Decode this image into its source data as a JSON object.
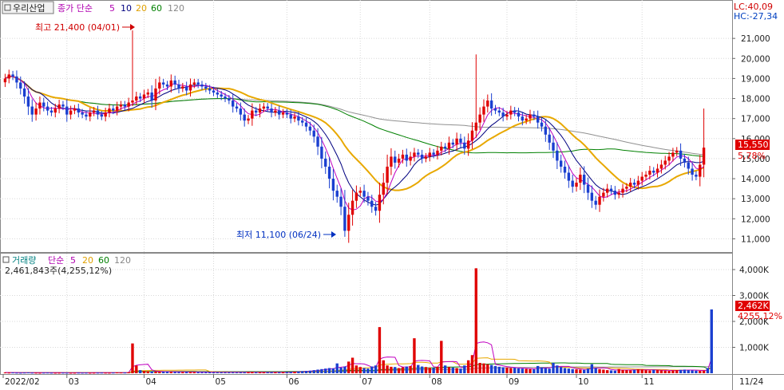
{
  "legend": {
    "stock_name": "우리산업",
    "ma_label": "종가 단순",
    "periods": [
      "5",
      "10",
      "20",
      "60",
      "120"
    ]
  },
  "readouts": {
    "lc": "LC:40,09",
    "hc": "HC:-27,34"
  },
  "annotations": {
    "high": "최고 21,400 (04/01)",
    "low": "최저 11,100 (06/24)"
  },
  "current": {
    "price": "15,550",
    "change": "5,78%",
    "volume": "2,462K",
    "volume_change": "4255,12%",
    "date": "11/24"
  },
  "volume_legend": {
    "label": "거래량",
    "ma_label": "단순",
    "periods": [
      "5",
      "20",
      "60",
      "120"
    ],
    "readout": "2,461,843주(4,255,12%)"
  },
  "colors": {
    "up": "#e00000",
    "down": "#1a3fd0",
    "ma5": "#c000c0",
    "ma10": "#000080",
    "ma20": "#e8a800",
    "ma60": "#008000",
    "ma120": "#909090",
    "grid": "#d8d8d8"
  },
  "chart_data": {
    "type": "candlestick",
    "price_axis": {
      "ticks": [
        "11,000",
        "12,000",
        "13,000",
        "14,000",
        "15,000",
        "16,000",
        "17,000",
        "18,000",
        "19,000",
        "20,000",
        "21,000"
      ],
      "range": [
        10500,
        22200
      ]
    },
    "volume_axis": {
      "ticks": [
        "1,000K",
        "2,000K",
        "3,000K",
        "4,000K"
      ],
      "range": [
        0,
        4400
      ]
    },
    "x_labels": [
      "2022/02",
      "03",
      "04",
      "05",
      "06",
      "07",
      "08",
      "09",
      "10",
      "11"
    ],
    "closes": [
      19000,
      19200,
      19100,
      18800,
      18500,
      18100,
      17600,
      17200,
      17500,
      17800,
      17600,
      17400,
      17300,
      17500,
      17700,
      17600,
      17200,
      17400,
      17500,
      17300,
      17200,
      17100,
      17300,
      17400,
      17200,
      17100,
      17300,
      17500,
      17400,
      17600,
      17700,
      17600,
      17800,
      17900,
      18100,
      18000,
      18200,
      18300,
      17900,
      18500,
      18800,
      18700,
      18600,
      18900,
      18700,
      18500,
      18600,
      18400,
      18700,
      18800,
      18700,
      18600,
      18500,
      18400,
      18300,
      18200,
      18100,
      18000,
      17900,
      17600,
      17500,
      17200,
      16900,
      17000,
      17400,
      17300,
      17500,
      17600,
      17500,
      17300,
      17400,
      17200,
      17300,
      17200,
      17000,
      17100,
      16900,
      16800,
      16600,
      16400,
      16100,
      15600,
      15000,
      14600,
      14000,
      13400,
      13100,
      12600,
      11400,
      12200,
      12900,
      13300,
      13400,
      13100,
      12900,
      12600,
      12400,
      13200,
      13800,
      14600,
      15100,
      14800,
      15000,
      15200,
      14900,
      15100,
      15300,
      15200,
      15000,
      15100,
      15300,
      15200,
      15400,
      15600,
      15500,
      15800,
      15700,
      16000,
      15800,
      15500,
      15900,
      16400,
      16800,
      17200,
      17600,
      17900,
      17500,
      17400,
      17300,
      17100,
      17200,
      17400,
      17300,
      17100,
      16900,
      17000,
      17200,
      17100,
      16800,
      16600,
      16200,
      15800,
      15400,
      14900,
      14600,
      14300,
      13900,
      13600,
      13800,
      14200,
      13700,
      13300,
      12900,
      12700,
      13100,
      13300,
      13500,
      13400,
      13200,
      13300,
      13500,
      13600,
      13800,
      13700,
      13900,
      14100,
      14200,
      14400,
      14300,
      14500,
      14700,
      14900,
      15100,
      15300,
      15400,
      15000,
      14800,
      14500,
      14200,
      14100,
      14700,
      15550
    ],
    "volumes": [
      30,
      25,
      28,
      22,
      20,
      25,
      30,
      22,
      20,
      18,
      22,
      25,
      20,
      18,
      20,
      22,
      20,
      18,
      19,
      22,
      20,
      21,
      18,
      20,
      22,
      24,
      21,
      20,
      25,
      30,
      28,
      26,
      35,
      1150,
      300,
      120,
      90,
      80,
      70,
      65,
      60,
      55,
      58,
      62,
      50,
      45,
      48,
      52,
      50,
      47,
      45,
      40,
      42,
      45,
      38,
      40,
      42,
      36,
      40,
      38,
      35,
      38,
      42,
      40,
      45,
      38,
      36,
      38,
      40,
      42,
      38,
      36,
      40,
      45,
      50,
      60,
      70,
      80,
      90,
      100,
      120,
      140,
      160,
      180,
      200,
      190,
      380,
      220,
      260,
      450,
      600,
      300,
      240,
      200,
      180,
      260,
      300,
      1780,
      500,
      300,
      250,
      240,
      200,
      230,
      260,
      280,
      1350,
      320,
      260,
      240,
      220,
      200,
      250,
      1250,
      300,
      240,
      220,
      200,
      180,
      300,
      500,
      700,
      4050,
      400,
      380,
      350,
      320,
      280,
      250,
      230,
      220,
      200,
      210,
      190,
      180,
      170,
      160,
      150,
      280,
      220,
      200,
      180,
      400,
      300,
      240,
      200,
      180,
      160,
      150,
      140,
      130,
      180,
      350,
      200,
      160,
      140,
      120,
      110,
      100,
      160,
      130,
      120,
      110,
      130,
      150,
      140,
      120,
      110,
      130,
      120,
      110,
      100,
      90,
      110,
      120,
      130,
      140,
      120,
      110,
      100,
      90,
      100,
      200,
      2462
    ]
  }
}
